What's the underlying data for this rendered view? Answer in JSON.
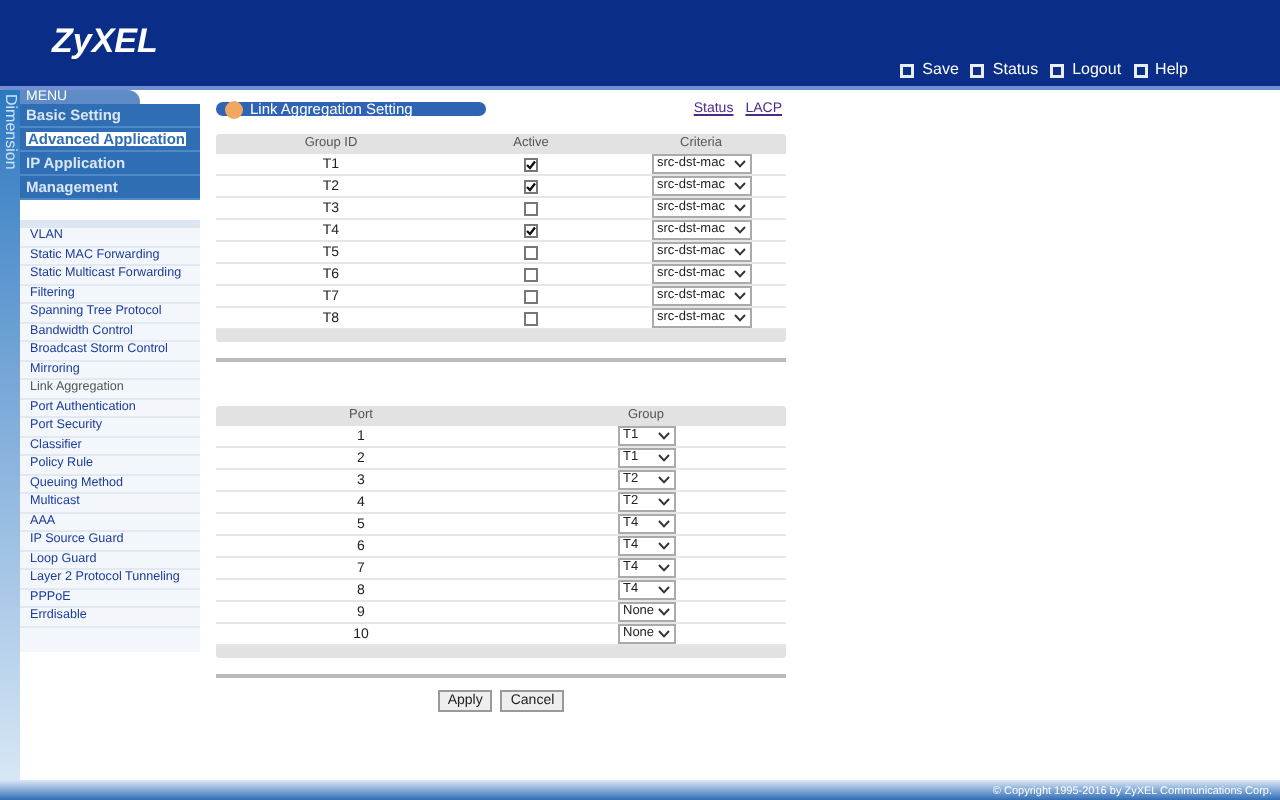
{
  "header": {
    "logo": "ZyXEL",
    "actions": [
      {
        "label": "Save"
      },
      {
        "label": "Status"
      },
      {
        "label": "Logout"
      },
      {
        "label": "Help"
      }
    ]
  },
  "side_strip": {
    "text": "Dimension"
  },
  "menu": {
    "title": "MENU",
    "items": [
      {
        "label": "Basic Setting",
        "selected": false
      },
      {
        "label": "Advanced Application",
        "selected": true
      },
      {
        "label": "IP Application",
        "selected": false
      },
      {
        "label": "Management",
        "selected": false
      }
    ],
    "subitems": [
      {
        "label": "VLAN",
        "selected": false
      },
      {
        "label": "Static MAC Forwarding",
        "selected": false
      },
      {
        "label": "Static Multicast Forwarding",
        "selected": false
      },
      {
        "label": "Filtering",
        "selected": false
      },
      {
        "label": "Spanning Tree Protocol",
        "selected": false
      },
      {
        "label": "Bandwidth Control",
        "selected": false
      },
      {
        "label": "Broadcast Storm Control",
        "selected": false
      },
      {
        "label": "Mirroring",
        "selected": false
      },
      {
        "label": "Link Aggregation",
        "selected": true
      },
      {
        "label": "Port Authentication",
        "selected": false
      },
      {
        "label": "Port Security",
        "selected": false
      },
      {
        "label": "Classifier",
        "selected": false
      },
      {
        "label": "Policy Rule",
        "selected": false
      },
      {
        "label": "Queuing Method",
        "selected": false
      },
      {
        "label": "Multicast",
        "selected": false
      },
      {
        "label": "AAA",
        "selected": false
      },
      {
        "label": "IP Source Guard",
        "selected": false
      },
      {
        "label": "Loop Guard",
        "selected": false
      },
      {
        "label": "Layer 2 Protocol Tunneling",
        "selected": false
      },
      {
        "label": "PPPoE",
        "selected": false
      },
      {
        "label": "Errdisable",
        "selected": false
      }
    ]
  },
  "page": {
    "title": "Link Aggregation Setting",
    "links": [
      "Status",
      "LACP"
    ]
  },
  "group_table": {
    "columns": [
      "Group ID",
      "Active",
      "Criteria"
    ],
    "rows": [
      {
        "group_id": "T1",
        "active": true,
        "criteria": "src-dst-mac"
      },
      {
        "group_id": "T2",
        "active": true,
        "criteria": "src-dst-mac"
      },
      {
        "group_id": "T3",
        "active": false,
        "criteria": "src-dst-mac"
      },
      {
        "group_id": "T4",
        "active": true,
        "criteria": "src-dst-mac"
      },
      {
        "group_id": "T5",
        "active": false,
        "criteria": "src-dst-mac"
      },
      {
        "group_id": "T6",
        "active": false,
        "criteria": "src-dst-mac"
      },
      {
        "group_id": "T7",
        "active": false,
        "criteria": "src-dst-mac"
      },
      {
        "group_id": "T8",
        "active": false,
        "criteria": "src-dst-mac"
      }
    ]
  },
  "port_table": {
    "columns": [
      "Port",
      "Group"
    ],
    "rows": [
      {
        "port": "1",
        "group": "T1"
      },
      {
        "port": "2",
        "group": "T1"
      },
      {
        "port": "3",
        "group": "T2"
      },
      {
        "port": "4",
        "group": "T2"
      },
      {
        "port": "5",
        "group": "T4"
      },
      {
        "port": "6",
        "group": "T4"
      },
      {
        "port": "7",
        "group": "T4"
      },
      {
        "port": "8",
        "group": "T4"
      },
      {
        "port": "9",
        "group": "None"
      },
      {
        "port": "10",
        "group": "None"
      }
    ]
  },
  "buttons": [
    "Apply",
    "Cancel"
  ],
  "footer": {
    "copyright": "© Copyright 1995-2016 by ZyXEL Communications Corp."
  }
}
